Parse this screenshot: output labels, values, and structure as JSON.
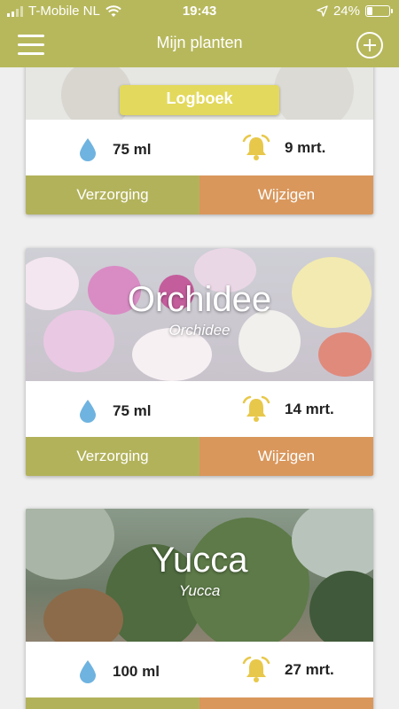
{
  "status_bar": {
    "carrier": "T-Mobile NL",
    "time": "19:43",
    "battery_percent": "24%",
    "battery_level": 0.24
  },
  "header": {
    "title": "Mijn planten",
    "menu_icon": "hamburger-menu-icon",
    "add_icon": "add-circle-icon"
  },
  "logbook_label": "Logboek",
  "buttons": {
    "care": "Verzorging",
    "edit": "Wijzigen"
  },
  "plants": [
    {
      "name": "",
      "latin": "",
      "water": "75 ml",
      "reminder": "9 mrt."
    },
    {
      "name": "Orchidee",
      "latin": "Orchidee",
      "water": "75 ml",
      "reminder": "14 mrt."
    },
    {
      "name": "Yucca",
      "latin": "Yucca",
      "water": "100 ml",
      "reminder": "27 mrt."
    }
  ],
  "colors": {
    "primary": "#b7b85c",
    "care_button": "#b2b25b",
    "edit_button": "#d9975c",
    "logbook": "#e3d95c",
    "water_drop": "#6fb3e0",
    "bell": "#e8c84a"
  }
}
